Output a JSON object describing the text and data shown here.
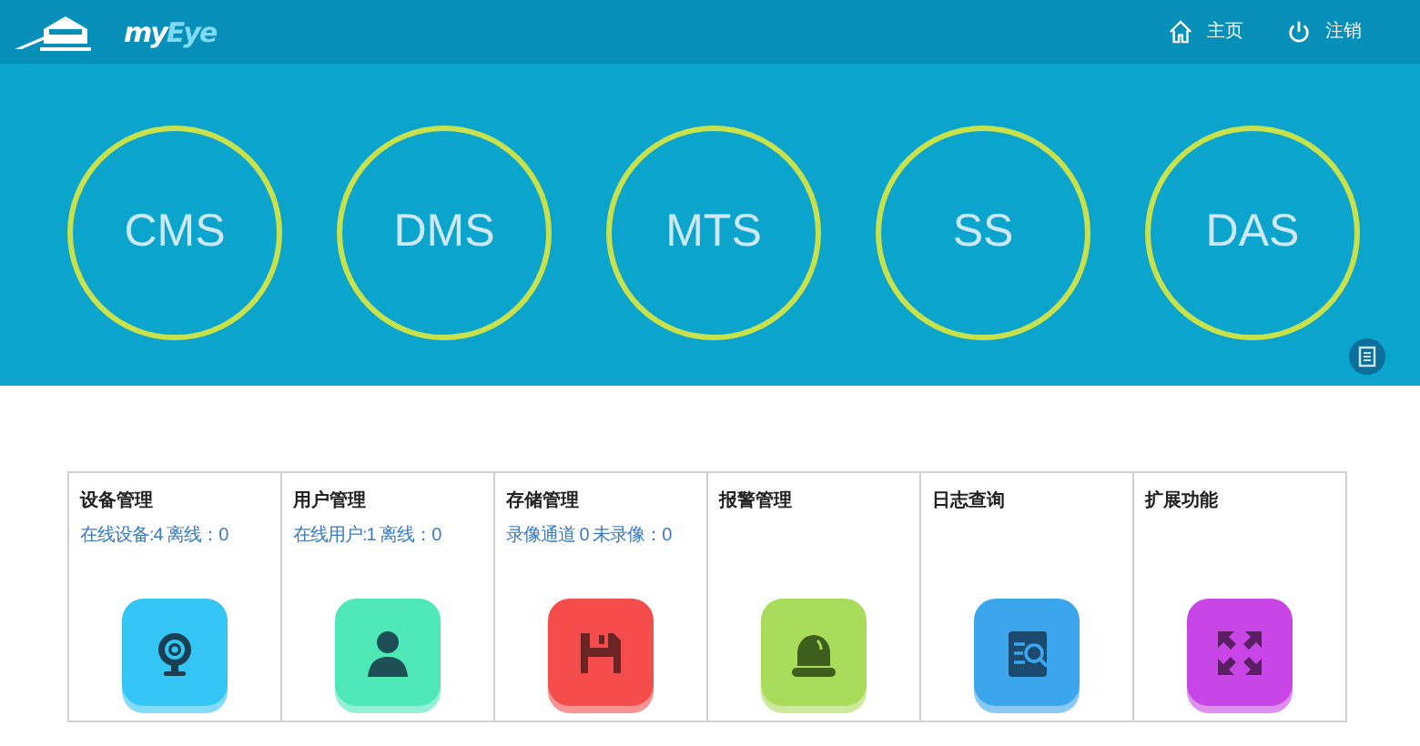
{
  "logo": {
    "text_1": "my",
    "text_2": "Eye"
  },
  "nav": [
    {
      "kind": "home",
      "label": "主页"
    },
    {
      "kind": "power",
      "label": "注销"
    }
  ],
  "servers": [
    {
      "label": "CMS"
    },
    {
      "label": "DMS"
    },
    {
      "label": "MTS"
    },
    {
      "label": "SS"
    },
    {
      "label": "DAS"
    }
  ],
  "modules": [
    {
      "title": "设备管理",
      "status": "在线设备:4 离线：0",
      "kind": "webcam",
      "color": "#33c5f3"
    },
    {
      "title": "用户管理",
      "status": "在线用户:1 离线：0",
      "kind": "user",
      "color": "#4de8b5"
    },
    {
      "title": "存储管理",
      "status": "录像通道 0 未录像：0",
      "kind": "floppy",
      "color": "#f54c4c"
    },
    {
      "title": "报警管理",
      "kind": "alarm",
      "color": "#a8dc5a"
    },
    {
      "title": "日志查询",
      "kind": "log",
      "color": "#3ba6ec"
    },
    {
      "title": "扩展功能",
      "kind": "expand",
      "color": "#c845e6"
    }
  ]
}
